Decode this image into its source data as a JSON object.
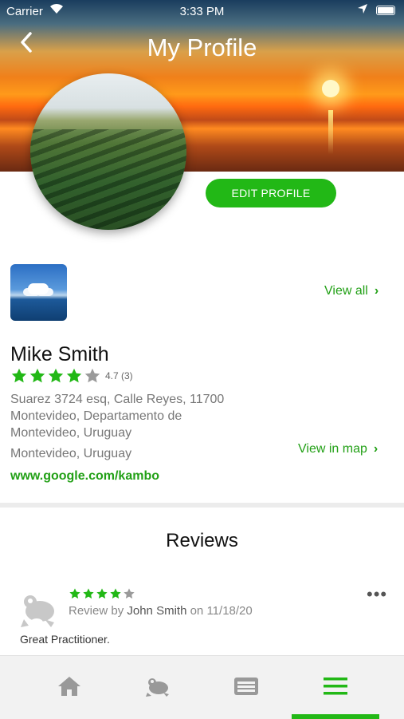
{
  "status_bar": {
    "carrier": "Carrier",
    "time": "3:33 PM"
  },
  "header": {
    "title": "My Profile"
  },
  "actions": {
    "edit_profile": "EDIT PROFILE"
  },
  "gallery": {
    "view_all": "View all"
  },
  "profile": {
    "name": "Mike Smith",
    "rating_value": 4.7,
    "rating_text": "4.7 (3)",
    "address": "Suarez 3724 esq, Calle Reyes, 11700 Montevideo, Departamento de Montevideo, Uruguay",
    "city": "Montevideo, Uruguay",
    "view_in_map": "View in map",
    "website": "www.google.com/kambo"
  },
  "reviews": {
    "title": "Reviews",
    "items": [
      {
        "stars": 4,
        "prefix": "Review by",
        "author": "John Smith",
        "on": "on",
        "date": "11/18/20",
        "text": "Great Practitioner."
      }
    ]
  },
  "colors": {
    "accent": "#22b816",
    "link": "#22a016"
  },
  "tabbar": {
    "items": [
      {
        "icon": "home-icon"
      },
      {
        "icon": "frog-icon"
      },
      {
        "icon": "list-icon"
      },
      {
        "icon": "menu-icon",
        "active": true
      }
    ]
  }
}
